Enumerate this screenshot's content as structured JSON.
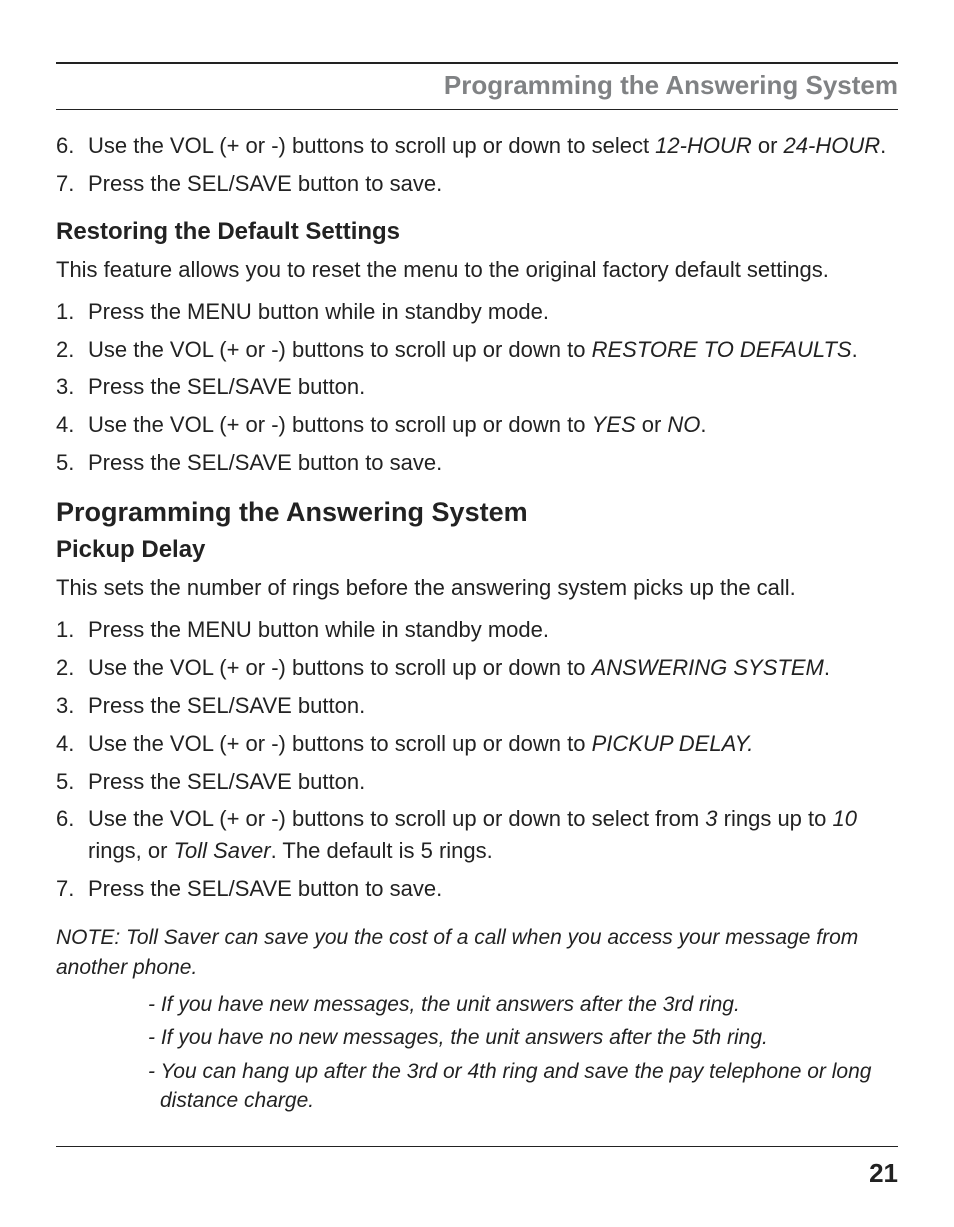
{
  "header": {
    "title": "Programming the Answering System"
  },
  "intro_list": {
    "items": [
      {
        "num": "6.",
        "before": "Use the VOL (+ or -) buttons to scroll up or down to select ",
        "it1": "12-HOUR",
        "mid": " or ",
        "it2": "24-HOUR",
        "after": "."
      },
      {
        "num": "7.",
        "before": "Press the SEL/SAVE button to save.",
        "it1": "",
        "mid": "",
        "it2": "",
        "after": ""
      }
    ]
  },
  "section_restore": {
    "heading": "Restoring the Default Settings",
    "para": "This feature allows you to reset the menu to the original factory default settings.",
    "items": [
      {
        "num": "1.",
        "before": "Press the MENU button while in standby mode.",
        "it1": "",
        "mid": "",
        "it2": "",
        "after": ""
      },
      {
        "num": "2.",
        "before": "Use the VOL (+ or -) buttons to scroll up or down to ",
        "it1": "RESTORE TO DEFAULTS",
        "mid": "",
        "it2": "",
        "after": "."
      },
      {
        "num": "3.",
        "before": "Press the SEL/SAVE button.",
        "it1": "",
        "mid": "",
        "it2": "",
        "after": ""
      },
      {
        "num": "4.",
        "before": "Use the VOL (+ or -) buttons to scroll up or down to ",
        "it1": "YES",
        "mid": " or ",
        "it2": "NO",
        "after": "."
      },
      {
        "num": "5.",
        "before": "Press the SEL/SAVE button to save.",
        "it1": "",
        "mid": "",
        "it2": "",
        "after": ""
      }
    ]
  },
  "section_prog": {
    "heading": "Programming the Answering System",
    "subheading": "Pickup Delay",
    "para": "This sets the number of rings before the answering system picks up the call.",
    "items": [
      {
        "num": "1.",
        "before": "Press the MENU button while in standby mode.",
        "it1": "",
        "mid": "",
        "it2": "",
        "after": ""
      },
      {
        "num": "2.",
        "before": "Use the VOL (+ or -) buttons to scroll up or down to ",
        "it1": "ANSWERING SYSTEM",
        "mid": "",
        "it2": "",
        "after": "."
      },
      {
        "num": "3.",
        "before": "Press the SEL/SAVE button.",
        "it1": "",
        "mid": "",
        "it2": "",
        "after": ""
      },
      {
        "num": "4.",
        "before": "Use the VOL (+ or -) buttons to scroll up or down to ",
        "it1": "PICKUP DELAY.",
        "mid": "",
        "it2": "",
        "after": ""
      },
      {
        "num": "5.",
        "before": "Press the SEL/SAVE button.",
        "it1": "",
        "mid": "",
        "it2": "",
        "after": ""
      },
      {
        "num": "6.",
        "before": "Use the VOL (+ or -) buttons to scroll up or down to select from ",
        "it1": "3",
        "mid": " rings up to ",
        "it2": "10",
        "after": " rings, or ",
        "it3": "Toll Saver",
        "tail": ". The default is 5 rings."
      },
      {
        "num": "7.",
        "before": "Press the SEL/SAVE button to save.",
        "it1": "",
        "mid": "",
        "it2": "",
        "after": ""
      }
    ],
    "note": "NOTE: Toll Saver can save you the cost of a call when you access your message from another phone.",
    "subnotes": [
      "- If you have new messages, the unit answers after the 3rd ring.",
      "- If you have no new messages, the unit answers after the 5th ring.",
      "- You can hang up after the 3rd or 4th ring and save the pay telephone or long distance charge."
    ]
  },
  "page_number": "21"
}
